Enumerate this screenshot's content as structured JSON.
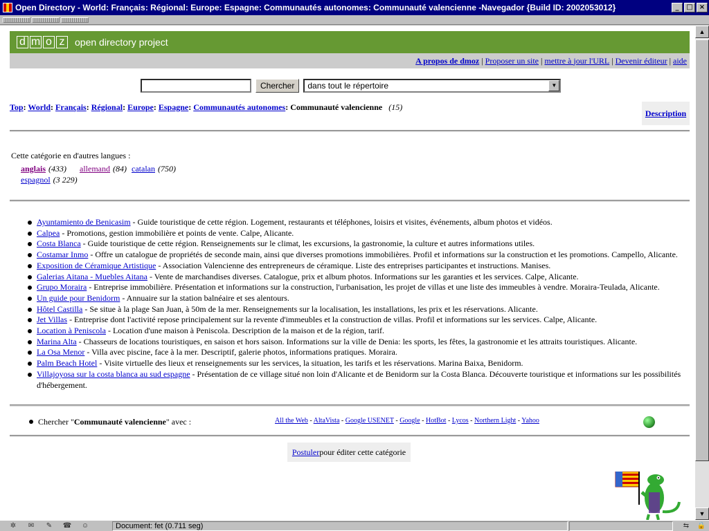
{
  "window": {
    "title": "Open Directory - World: Français: Régional: Europe: Espagne: Communautés autonomes: Communauté valencienne -Navegador {Build ID: 2002053012}",
    "minimize": "_",
    "maximize": "□",
    "close": "×"
  },
  "header": {
    "logo_letters": [
      "d",
      "m",
      "o",
      "z"
    ],
    "logo_tagline": "open directory project",
    "links": [
      "A propos de dmoz",
      "Proposer un site",
      "mettre à jour l'URL",
      "Devenir éditeur",
      "aide"
    ],
    "separator": "|"
  },
  "search": {
    "input_value": "",
    "button_label": "Chercher",
    "scope_selected": "dans tout le répertoire",
    "dropdown_arrow": "▼"
  },
  "breadcrumb": {
    "items": [
      "Top",
      "World",
      "Français",
      "Régional",
      "Europe",
      "Espagne",
      "Communautés autonomes"
    ],
    "current": "Communauté valencienne",
    "count": "(15)",
    "separator": ":",
    "description_link": "Description"
  },
  "languages": {
    "intro": "Cette catégorie en d'autres langues :",
    "items": [
      {
        "name": "anglais",
        "count": "(433)"
      },
      {
        "name": "allemand",
        "count": "(84)"
      },
      {
        "name": "catalan",
        "count": "(750)"
      },
      {
        "name": "espagnol",
        "count": "(3 229)"
      }
    ]
  },
  "listings": [
    {
      "title": "Ayuntamiento de Benicasim",
      "desc": " - Guide touristique de cette région. Logement, restaurants et téléphones, loisirs et visites, événements, album photos et vidéos."
    },
    {
      "title": "Calpea",
      "desc": " - Promotions, gestion immobilière et points de vente. Calpe, Alicante."
    },
    {
      "title": "Costa Blanca",
      "desc": " - Guide touristique de cette région. Renseignements sur le climat, les excursions, la gastronomie, la culture et autres informations utiles."
    },
    {
      "title": "Costamar Inmo",
      "desc": " - Offre un catalogue de propriétés de seconde main, ainsi que diverses promotions immobilières. Profil et informations sur la construction et les promotions. Campello, Alicante."
    },
    {
      "title": "Exposition de Céramique Artistique",
      "desc": " - Association Valencienne des entrepreneurs de céramique. Liste des entreprises participantes et instructions. Manises."
    },
    {
      "title": "Galerias Aitana - Muebles Aitana",
      "desc": " - Vente de marchandises diverses. Catalogue, prix et album photos. Informations sur les garanties et les services. Calpe, Alicante."
    },
    {
      "title": "Grupo Moraira",
      "desc": " - Entreprise immobilière. Présentation et informations sur la construction, l'urbanisation, les projet de villas et une liste des immeubles à vendre. Moraira-Teulada, Alicante."
    },
    {
      "title": "Un guide pour Benidorm",
      "desc": " - Annuaire sur la station balnéaire et ses alentours."
    },
    {
      "title": "Hôtel Castilla",
      "desc": " - Se situe à la plage San Juan, à 50m de la mer. Renseignements sur la localisation, les installations, les prix et les réservations. Alicante."
    },
    {
      "title": "Jet Villas",
      "desc": " - Entreprise dont l'activité repose principalement sur la revente d'immeubles et la construction de villas. Profil et informations sur les services. Calpe, Alicante."
    },
    {
      "title": "Location à Peniscola",
      "desc": " - Location d'une maison à Peniscola. Description de la maison et de la région, tarif."
    },
    {
      "title": "Marina Alta",
      "desc": " - Chasseurs de locations touristiques, en saison et hors saison. Informations sur la ville de Denia: les sports, les fêtes, la gastronomie et les attraits touristiques. Alicante."
    },
    {
      "title": "La Osa Menor",
      "desc": " - Villa avec piscine, face à la mer. Descriptif, galerie photos, informations pratiques. Moraira."
    },
    {
      "title": "Palm Beach Hotel",
      "desc": " - Visite virtuelle des lieux et renseignements sur les services, la situation, les tarifs et les réservations. Marina Baixa, Benidorm."
    },
    {
      "title": "Villajoyosa sur la costa blanca au sud espagne",
      "desc": " - Présentation de ce village situé non loin d'Alicante et de Benidorm sur la Costa Blanca. Découverte touristique et informations sur les possibilités d'hébergement."
    }
  ],
  "other_search": {
    "prefix": "Chercher \"",
    "term": "Communauté valencienne",
    "suffix": "\" avec :",
    "engines": [
      "All the Web",
      "AltaVista",
      "Google USENET",
      "Google",
      "HotBot",
      "Lycos",
      "Northern Light",
      "Yahoo"
    ],
    "separator": " - "
  },
  "edit": {
    "link": "Postuler",
    "text": " pour éditer cette catégorie"
  },
  "status": {
    "text": "Document: fet (0.711 seg)"
  },
  "colors": {
    "dmoz_green": "#669933",
    "link": "#0000cc",
    "visited": "#800080",
    "titlebar": "#000080"
  }
}
